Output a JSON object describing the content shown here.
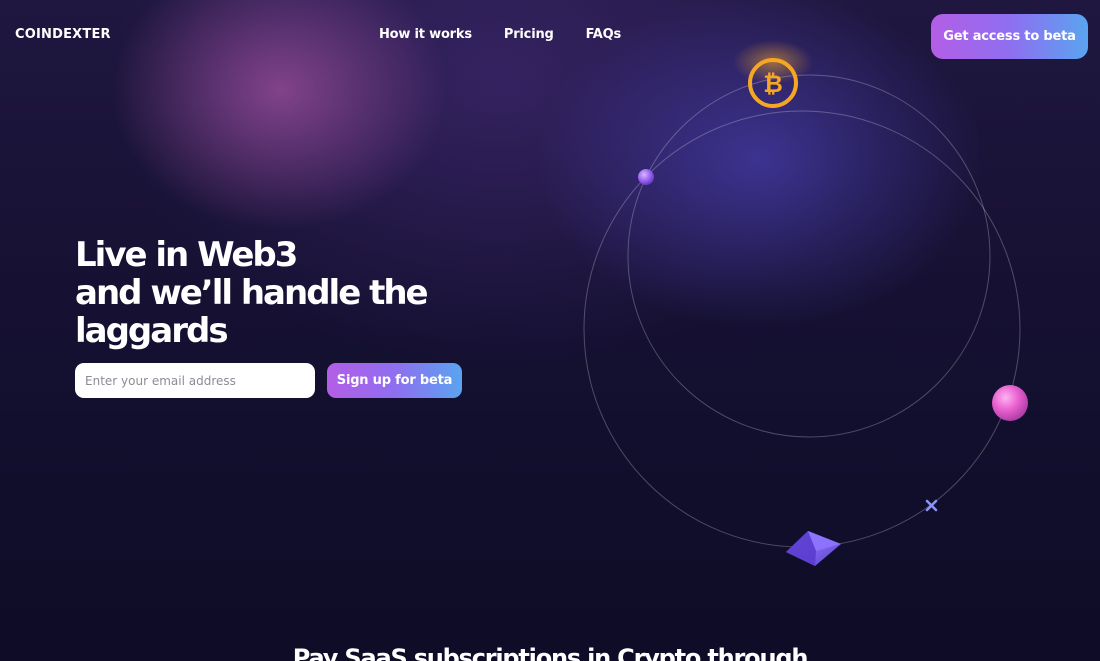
{
  "brand": {
    "logo_text": "COINDEXTER"
  },
  "nav": {
    "items": [
      {
        "label": "How it works"
      },
      {
        "label": "Pricing"
      },
      {
        "label": "FAQs"
      }
    ],
    "cta_label": "Get access to beta"
  },
  "hero": {
    "title_lines": [
      "Live in Web3",
      "and we’ll handle the",
      "laggards"
    ],
    "email_placeholder": "Enter your email address",
    "email_value": "",
    "signup_label": "Sign up for beta"
  },
  "illustration": {
    "icons": [
      "bitcoin-coin-icon",
      "purple-orb-icon",
      "pink-orb-icon",
      "cross-sparkle-icon",
      "ethereum-crystal-icon"
    ]
  },
  "next_section": {
    "heading": "Pay SaaS subscriptions in Crypto through"
  },
  "colors": {
    "background": "#120f2e",
    "gradient_start": "#b35ee6",
    "gradient_end": "#5aa4f0",
    "bitcoin": "#f5a623",
    "orb_pink": "#e85fd0",
    "ethereum": "#7a5ce8"
  }
}
